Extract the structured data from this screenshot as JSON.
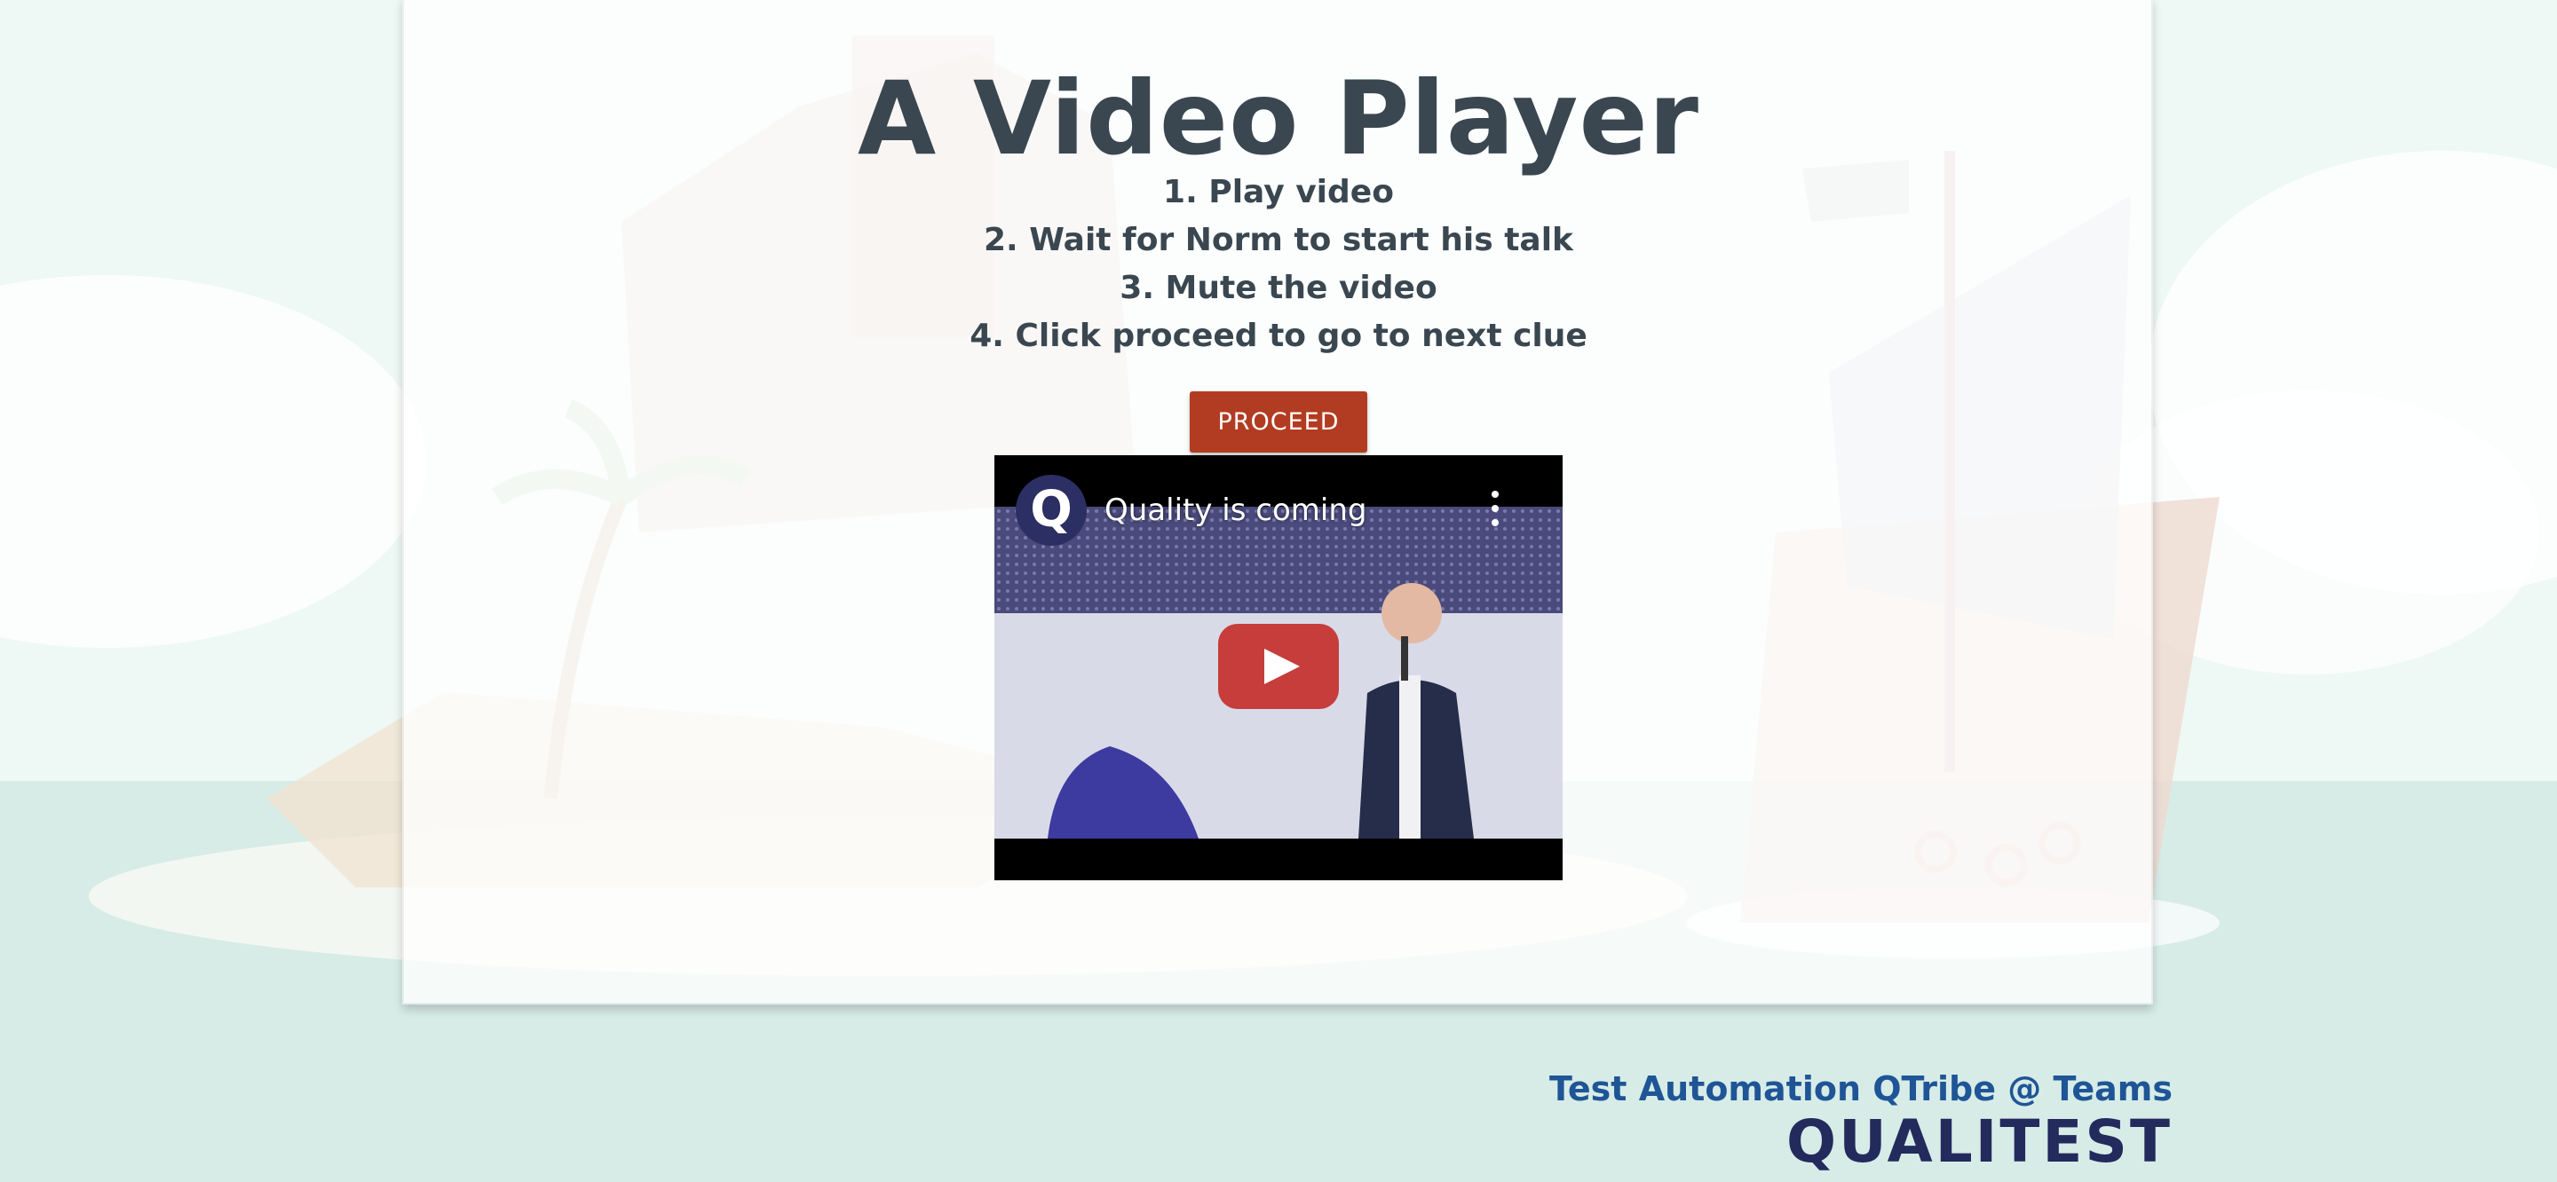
{
  "page": {
    "title": "A Video Player",
    "steps": [
      "1. Play video",
      "2. Wait for Norm to start his talk",
      "3. Mute the video",
      "4. Click proceed to go to next clue"
    ],
    "proceed_label": "PROCEED"
  },
  "video": {
    "title": "Quality is coming",
    "channel_initial": "Q",
    "icons": [
      "channel-avatar",
      "more-vert-icon",
      "play-icon"
    ]
  },
  "footer": {
    "tagline": "Test Automation QTribe @ Teams",
    "logo": "QUALITEST"
  },
  "colors": {
    "heading": "#3a4750",
    "proceed_button": "#b23c21",
    "footer_text": "#1f5596",
    "logo": "#232a5c",
    "youtube_red": "#c4302b"
  }
}
